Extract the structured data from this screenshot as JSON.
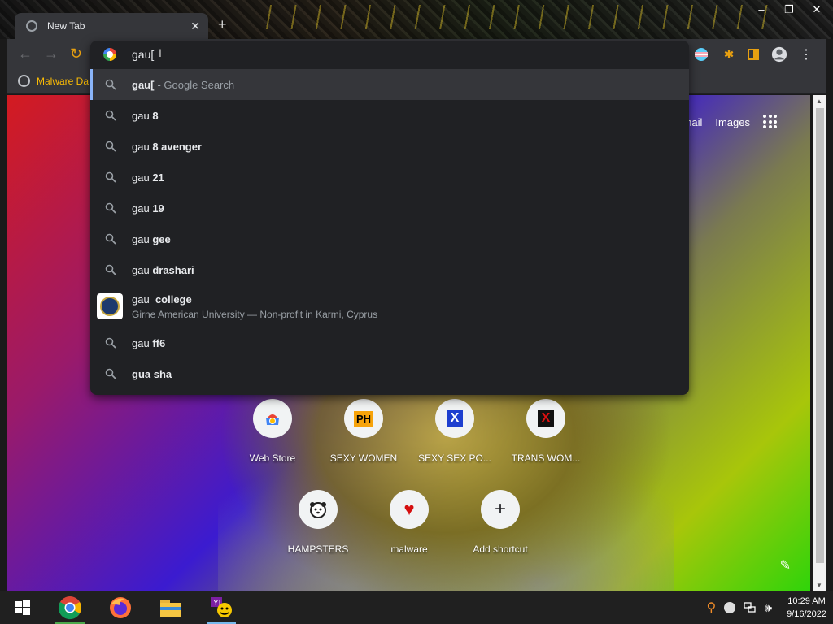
{
  "browser": {
    "tab_title": "New Tab",
    "tab_close": "✕",
    "new_tab": "+",
    "window_buttons": [
      "–",
      "❐",
      "✕"
    ],
    "bookmark": "Malware Da"
  },
  "omnibox": {
    "typed": "gau[",
    "suggestions": [
      {
        "typed": "gau[",
        "rest": "",
        "hint": "- Google Search",
        "selected": true
      },
      {
        "typed": "gau ",
        "rest": "8"
      },
      {
        "typed": "gau ",
        "rest": "8 avenger"
      },
      {
        "typed": "gau ",
        "rest": "21"
      },
      {
        "typed": "gau ",
        "rest": "19"
      },
      {
        "typed": "gau ",
        "rest": "gee"
      },
      {
        "typed": "gau ",
        "rest": "drashari"
      },
      {
        "typed": "gau ",
        "rest": "college",
        "desc": "Girne American University — Non-profit in Karmi, Cyprus"
      },
      {
        "typed": "gau ",
        "rest": "ff6"
      },
      {
        "typed": "",
        "rest": "gua sha"
      }
    ]
  },
  "page": {
    "top_links": [
      "mail",
      "Images"
    ],
    "shortcuts": [
      {
        "label": "Web Store",
        "icon": "webstore-icon"
      },
      {
        "label": "SEXY WOMEN",
        "icon_text": "PH"
      },
      {
        "label": "SEXY SEX PO...",
        "icon_text": "X"
      },
      {
        "label": "TRANS WOM...",
        "icon_text": "X"
      },
      {
        "label": "HAMPSTERS",
        "icon": "hamster-icon"
      },
      {
        "label": "malware",
        "icon_text": "♥"
      },
      {
        "label": "Add shortcut",
        "icon_text": "+"
      }
    ]
  },
  "taskbar": {
    "time": "10:29 AM",
    "date": "9/16/2022"
  }
}
